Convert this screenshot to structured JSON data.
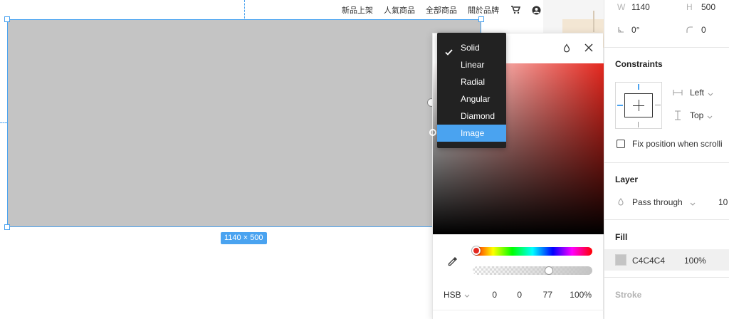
{
  "nav": {
    "items": [
      "新品上架",
      "人氣商品",
      "全部商品",
      "關於品牌"
    ],
    "cart_icon": "cart-icon",
    "account_icon": "user-icon"
  },
  "canvas": {
    "dimension_label": "1140 × 500"
  },
  "fill_dropdown": {
    "options": [
      "Solid",
      "Linear",
      "Radial",
      "Angular",
      "Diamond",
      "Image"
    ],
    "checked": "Solid",
    "highlighted": "Image"
  },
  "color_picker": {
    "mode": "HSB",
    "h": "0",
    "s": "0",
    "b": "77",
    "alpha": "100%"
  },
  "properties": {
    "w_label": "W",
    "w_value": "1140",
    "h_label": "H",
    "h_value": "500",
    "rotation": "0°",
    "radius": "0",
    "constraints_title": "Constraints",
    "horizontal_constraint": "Left",
    "vertical_constraint": "Top",
    "fix_position_label": "Fix position when scrolli",
    "layer_title": "Layer",
    "blend_mode": "Pass through",
    "opacity_partial": "10",
    "fill_title": "Fill",
    "fill_hex": "C4C4C4",
    "fill_opacity": "100%",
    "stroke_title": "Stroke"
  },
  "colors": {
    "selection_blue": "#4aa3f0",
    "fill_gray": "#c4c4c4",
    "hue_red": "#e4281f",
    "menu_dark": "#222222"
  }
}
